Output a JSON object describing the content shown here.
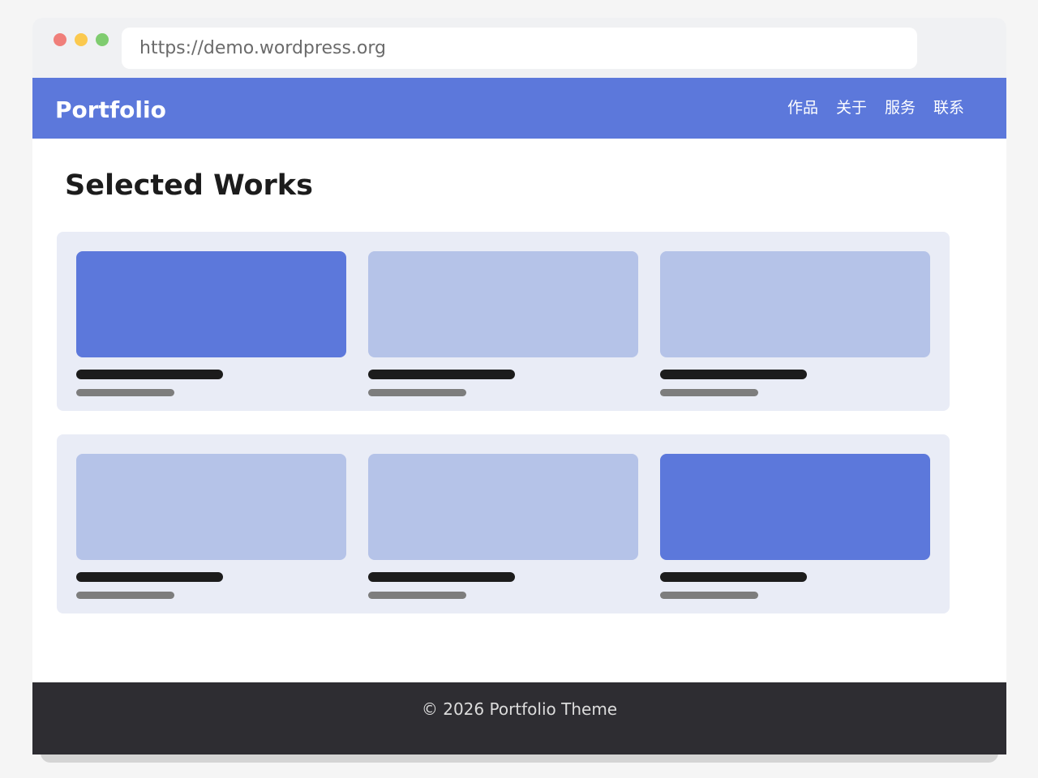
{
  "browser": {
    "url": "https://demo.wordpress.org"
  },
  "header": {
    "brand": "Portfolio",
    "nav": [
      {
        "label": "作品"
      },
      {
        "label": "关于"
      },
      {
        "label": "服务"
      },
      {
        "label": "联系"
      }
    ]
  },
  "main": {
    "title": "Selected Works",
    "rows": [
      {
        "cards": [
          {
            "highlighted": true
          },
          {
            "highlighted": false
          },
          {
            "highlighted": false
          }
        ]
      },
      {
        "cards": [
          {
            "highlighted": false
          },
          {
            "highlighted": false
          },
          {
            "highlighted": true
          }
        ]
      }
    ]
  },
  "footer": {
    "text": "© 2026 Portfolio Theme"
  },
  "colors": {
    "accent": "#5c78db",
    "thumb_muted": "#b5c3e8",
    "row_background": "#e9ecf6",
    "footer_background": "#2e2d32"
  }
}
